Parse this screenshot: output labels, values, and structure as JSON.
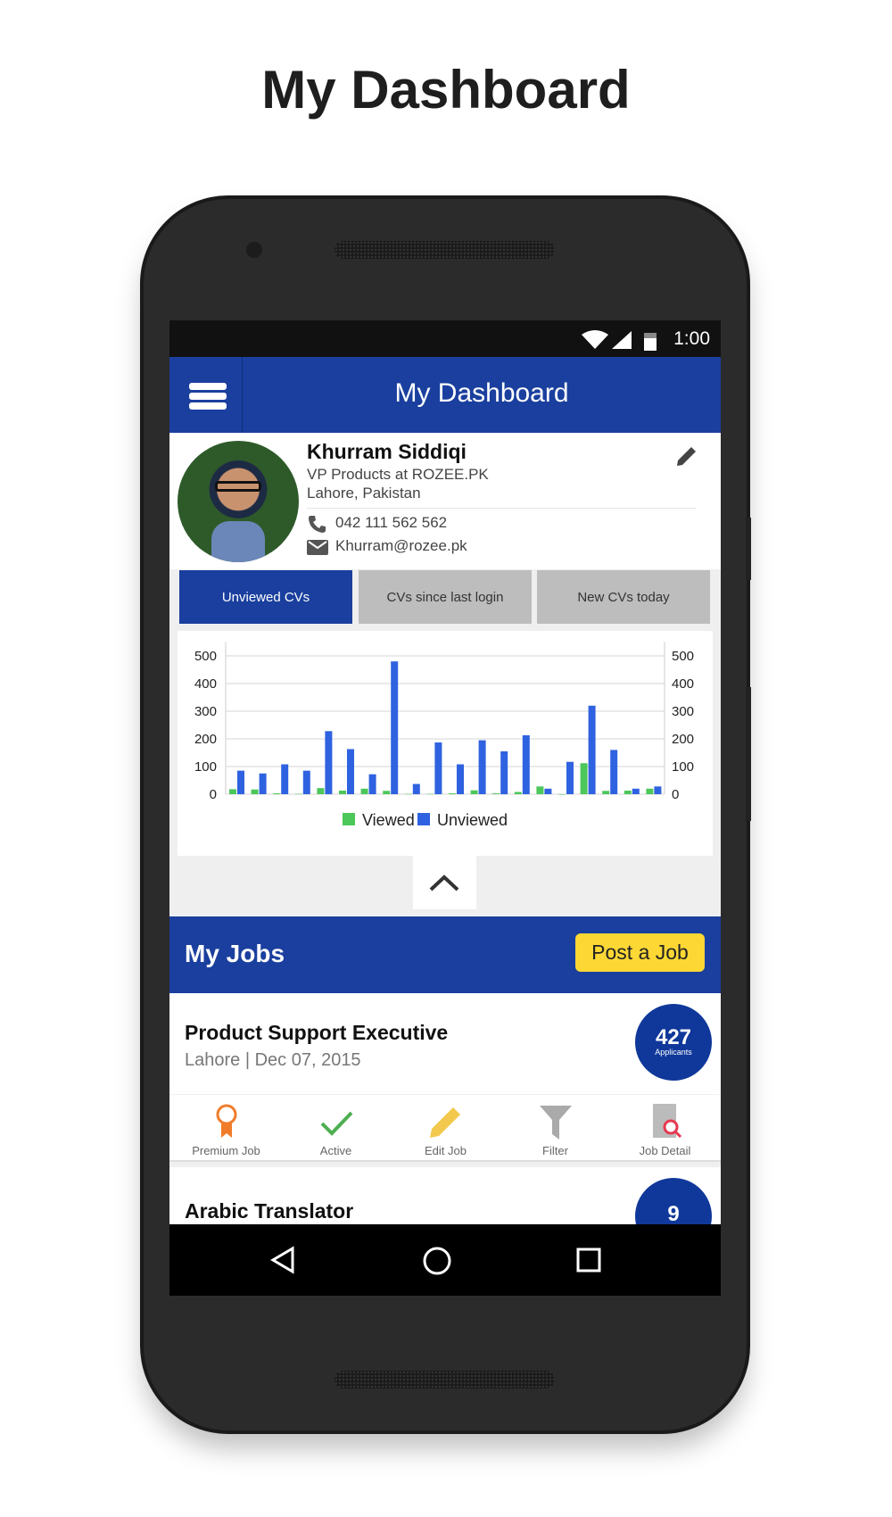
{
  "page_title": "My Dashboard",
  "status_bar": {
    "time": "1:00"
  },
  "app_bar": {
    "title": "My Dashboard",
    "menu_icon": "hamburger-icon"
  },
  "profile": {
    "name": "Khurram Siddiqi",
    "position": "VP Products at ROZEE.PK",
    "location": "Lahore, Pakistan",
    "phone": "042 111 562 562",
    "email": "Khurram@rozee.pk"
  },
  "tabs": [
    {
      "label": "Unviewed CVs",
      "active": true
    },
    {
      "label": "CVs since last login",
      "active": false
    },
    {
      "label": "New CVs today",
      "active": false
    }
  ],
  "colors": {
    "primary": "#1a3f9e",
    "accent": "#fdd835",
    "viewed": "#4cc75a",
    "unviewed": "#2f62e0"
  },
  "chart_data": {
    "type": "bar",
    "yticks": [
      "0",
      "100",
      "200",
      "300",
      "400",
      "500"
    ],
    "ylim": [
      0,
      550
    ],
    "grid": true,
    "legend": "bottom",
    "series": [
      {
        "name": "Viewed",
        "values": [
          18,
          17,
          3,
          1,
          22,
          13,
          20,
          12,
          1,
          1,
          3,
          14,
          3,
          8,
          28,
          0,
          112,
          12,
          13,
          20
        ]
      },
      {
        "name": "Unviewed",
        "values": [
          85,
          75,
          108,
          85,
          228,
          163,
          72,
          480,
          37,
          187,
          108,
          195,
          155,
          213,
          20,
          117,
          320,
          160,
          20,
          28
        ]
      }
    ]
  },
  "jobs_section": {
    "title": "My Jobs",
    "post_button": "Post a Job"
  },
  "jobs": [
    {
      "title": "Product Support Executive",
      "meta": "Lahore | Dec 07, 2015",
      "applicants": "427",
      "applicants_label": "Applicants"
    },
    {
      "title": "Arabic Translator",
      "applicants": "9"
    }
  ],
  "job_actions": [
    {
      "label": "Premium Job",
      "icon": "ribbon-icon"
    },
    {
      "label": "Active",
      "icon": "check-icon"
    },
    {
      "label": "Edit Job",
      "icon": "pencil-icon"
    },
    {
      "label": "Filter",
      "icon": "filter-icon"
    },
    {
      "label": "Job Detail",
      "icon": "document-search-icon"
    }
  ]
}
